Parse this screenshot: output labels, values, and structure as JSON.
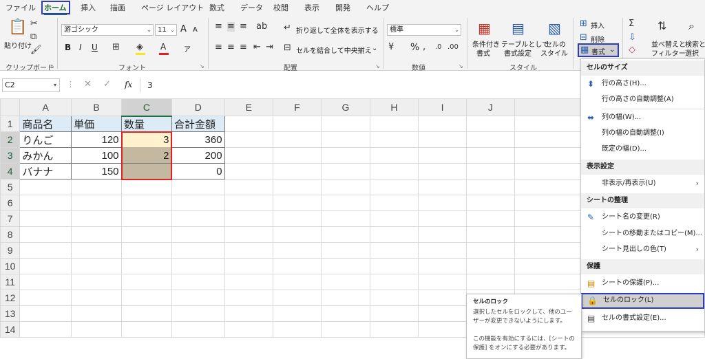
{
  "menu_tabs": [
    "ファイル",
    "ホーム",
    "挿入",
    "描画",
    "ページ レイアウト",
    "数式",
    "データ",
    "校閲",
    "表示",
    "開発",
    "ヘルプ"
  ],
  "active_tab": "ホーム",
  "ribbon": {
    "clipboard": {
      "paste_label": "貼り付け",
      "group_label": "クリップボード"
    },
    "font": {
      "font_name": "游ゴシック",
      "font_size": "11",
      "group_label": "フォント",
      "grow": "A",
      "shrink": "A",
      "bold": "B",
      "italic": "I",
      "underline": "U",
      "ruby": "ア"
    },
    "alignment": {
      "wrap_label": "折り返して全体を表示する",
      "merge_label": "セルを結合して中央揃え",
      "group_label": "配置"
    },
    "number": {
      "format": "標準",
      "percent": "%",
      "group_label": "数値"
    },
    "styles": {
      "cond_format_1": "条件付き",
      "cond_format_2": "書式",
      "table_fmt_1": "テーブルとして",
      "table_fmt_2": "書式設定",
      "cell_style_1": "セルの",
      "cell_style_2": "スタイル",
      "group_label": "スタイル"
    },
    "cells": {
      "insert": "挿入",
      "delete": "削除",
      "format": "書式"
    },
    "editing": {
      "sort_filter_1": "並べ替えと",
      "sort_filter_2": "フィルター",
      "find_1": "検索と",
      "find_2": "選択"
    }
  },
  "formula_bar": {
    "name_box": "C2",
    "fx": "fx",
    "value": "3"
  },
  "columns": [
    "A",
    "B",
    "C",
    "D",
    "E",
    "F",
    "G",
    "H",
    "I",
    "J"
  ],
  "rows": [
    "1",
    "2",
    "3",
    "4",
    "5",
    "6",
    "7",
    "8",
    "9",
    "10",
    "11",
    "12",
    "13",
    "14"
  ],
  "sheet": {
    "header": [
      "商品名",
      "単価",
      "数量",
      "合計金額"
    ],
    "data": [
      [
        "りんご",
        "120",
        "3",
        "360"
      ],
      [
        "みかん",
        "100",
        "2",
        "200"
      ],
      [
        "バナナ",
        "150",
        "",
        "0"
      ]
    ]
  },
  "format_menu": {
    "sections": [
      {
        "title": "セルのサイズ",
        "items": [
          "行の高さ(H)...",
          "行の高さの自動調整(A)",
          "列の幅(W)...",
          "列の幅の自動調整(I)",
          "既定の幅(D)..."
        ]
      },
      {
        "title": "表示設定",
        "items": [
          "非表示/再表示(U)"
        ]
      },
      {
        "title": "シートの整理",
        "items": [
          "シート名の変更(R)",
          "シートの移動またはコピー(M)...",
          "シート見出しの色(T)"
        ]
      },
      {
        "title": "保護",
        "items": [
          "シートの保護(P)...",
          "セルのロック(L)",
          "セルの書式設定(E)..."
        ]
      }
    ]
  },
  "tooltip": {
    "title": "セルのロック",
    "line1": "選択したセルをロックして、他のユー",
    "line2": "ザーが変更できないようにします。",
    "line3": "この機能を有効にするには、[シートの",
    "line4": "保護] をオンにする必要があります。"
  },
  "colors": {
    "accent": "#217346",
    "highlight_box": "#2f3dbd",
    "selection_border": "#e02020",
    "c2_fill": "#fff2cc",
    "c34_fill": "#c4b9a0",
    "header_fill": "#ddebf7"
  }
}
